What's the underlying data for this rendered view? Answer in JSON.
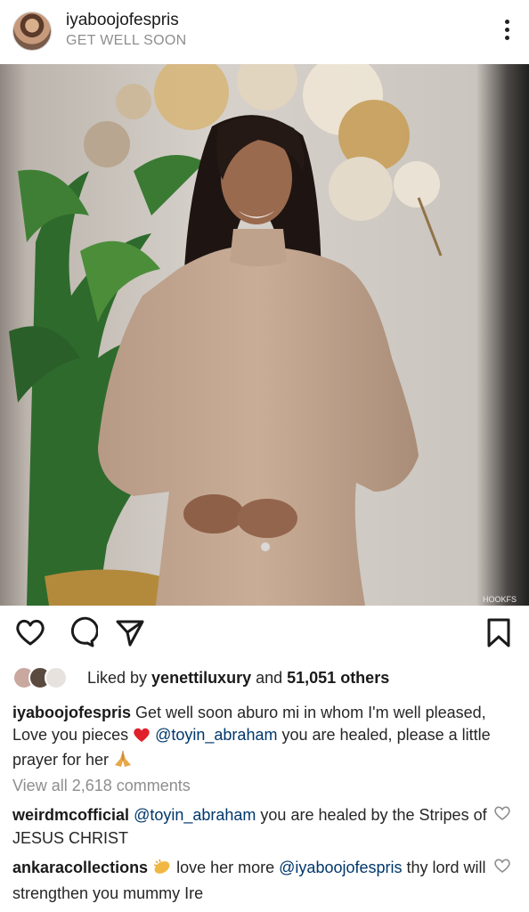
{
  "post": {
    "header": {
      "username": "iyaboojofespris",
      "subtitle": "GET WELL SOON",
      "more_icon": "more-vertical-icon"
    },
    "photo": {
      "watermark": "HOOKFS"
    },
    "actions": {
      "like_icon": "heart-icon",
      "comment_icon": "comment-icon",
      "share_icon": "send-icon",
      "save_icon": "bookmark-icon"
    },
    "likes": {
      "prefix": "Liked by ",
      "user": "yenettiluxury",
      "middle": " and ",
      "count": "51,051 others"
    },
    "caption": {
      "username": "iyaboojofespris",
      "text_1": " Get well soon aburo mi in whom I'm well pleased, Love you pieces ",
      "mention": "@toyin_abraham",
      "text_2": " you are healed, please a little prayer for her "
    },
    "view_all_comments": "View all 2,618 comments",
    "comments": [
      {
        "username": "weirdmcofficial",
        "mention": "@toyin_abraham",
        "text": " you are healed by the Stripes of JESUS CHRIST"
      },
      {
        "username": "ankaracollections",
        "text_1": " love her more ",
        "mention": "@iyaboojofespris",
        "text_2": " thy lord will strengthen you mummy Ire"
      }
    ]
  }
}
